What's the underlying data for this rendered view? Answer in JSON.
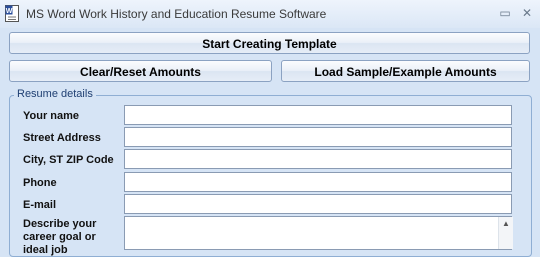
{
  "window": {
    "title": "MS Word Work History and Education Resume Software",
    "minimize_glyph": "▭",
    "close_glyph": "✕"
  },
  "buttons": {
    "start": "Start Creating Template",
    "clear": "Clear/Reset Amounts",
    "load_sample": "Load Sample/Example Amounts"
  },
  "group": {
    "title": "Resume details"
  },
  "fields": {
    "name": {
      "label": "Your name",
      "value": ""
    },
    "street": {
      "label": "Street Address",
      "value": ""
    },
    "city": {
      "label": "City, ST  ZIP Code",
      "value": ""
    },
    "phone": {
      "label": "Phone",
      "value": ""
    },
    "email": {
      "label": "E-mail",
      "value": ""
    },
    "goal": {
      "label": "Describe your career goal or ideal job",
      "value": ""
    }
  },
  "icons": {
    "app": "word-document-icon",
    "minimize": "minimize-icon",
    "close": "close-icon",
    "scroll_up": "scroll-up-arrow-icon"
  },
  "colors": {
    "window_bg": "#d6e4f5",
    "group_border": "#8faed3",
    "group_title": "#1f3f72"
  }
}
